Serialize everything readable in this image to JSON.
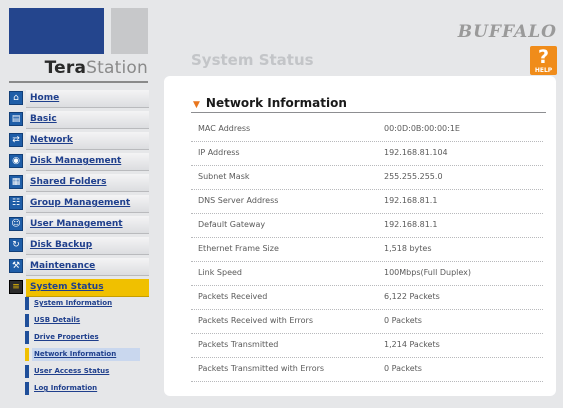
{
  "logo": {
    "part1": "Tera",
    "part2": "Station"
  },
  "brand": "BUFFALO",
  "help": {
    "symbol": "?",
    "label": "HELP"
  },
  "page_title": "System Status",
  "nav": {
    "items": [
      {
        "label": "Home",
        "icon": "home-icon"
      },
      {
        "label": "Basic",
        "icon": "basic-icon"
      },
      {
        "label": "Network",
        "icon": "network-icon"
      },
      {
        "label": "Disk Management",
        "icon": "disk-icon"
      },
      {
        "label": "Shared Folders",
        "icon": "folder-icon"
      },
      {
        "label": "Group Management",
        "icon": "group-icon"
      },
      {
        "label": "User Management",
        "icon": "user-icon"
      },
      {
        "label": "Disk Backup",
        "icon": "backup-icon"
      },
      {
        "label": "Maintenance",
        "icon": "maintenance-icon"
      },
      {
        "label": "System Status",
        "icon": "status-icon"
      }
    ],
    "active": "System Status",
    "sub_items": [
      {
        "label": "System Information"
      },
      {
        "label": "USB Details"
      },
      {
        "label": "Drive Properties"
      },
      {
        "label": "Network Information"
      },
      {
        "label": "User Access Status"
      },
      {
        "label": "Log Information"
      }
    ],
    "active_sub": "Network Information"
  },
  "section": {
    "title": "Network Information"
  },
  "rows": [
    {
      "label": "MAC Address",
      "value": "00:0D:0B:00:00:1E"
    },
    {
      "label": "IP Address",
      "value": "192.168.81.104"
    },
    {
      "label": "Subnet Mask",
      "value": "255.255.255.0"
    },
    {
      "label": "DNS Server Address",
      "value": "192.168.81.1"
    },
    {
      "label": "Default Gateway",
      "value": "192.168.81.1"
    },
    {
      "label": "Ethernet Frame Size",
      "value": "1,518 bytes"
    },
    {
      "label": "Link Speed",
      "value": "100Mbps(Full Duplex)"
    },
    {
      "label": "Packets Received",
      "value": "6,122 Packets"
    },
    {
      "label": "Packets Received with Errors",
      "value": "0 Packets"
    },
    {
      "label": "Packets Transmitted",
      "value": "1,214 Packets"
    },
    {
      "label": "Packets Transmitted with Errors",
      "value": "0 Packets"
    }
  ],
  "colors": {
    "accent": "#f0c000",
    "nav_text": "#1f3f8c",
    "help": "#f08c1a",
    "bullet": "#e8761e"
  }
}
